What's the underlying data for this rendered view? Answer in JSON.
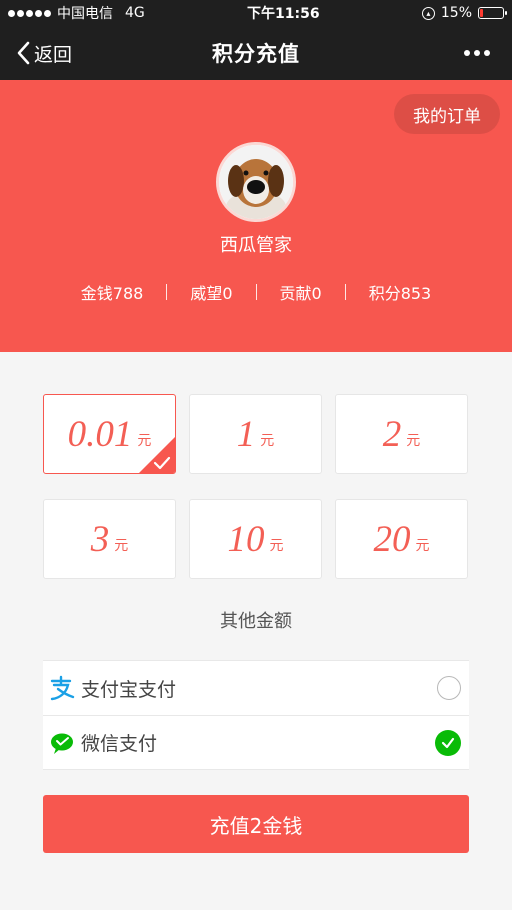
{
  "status_bar": {
    "carrier": "中国电信",
    "network": "4G",
    "time": "下午11:56",
    "battery_percent": "15%",
    "battery_level": 0.15
  },
  "nav": {
    "back_label": "返回",
    "title": "积分充值"
  },
  "header": {
    "orders_label": "我的订单",
    "username": "西瓜管家",
    "stats": [
      {
        "label": "金钱788"
      },
      {
        "label": "威望0"
      },
      {
        "label": "贡献0"
      },
      {
        "label": "积分853"
      }
    ]
  },
  "amounts": [
    {
      "value": "0.01",
      "unit": "元",
      "selected": true
    },
    {
      "value": "1",
      "unit": "元",
      "selected": false
    },
    {
      "value": "2",
      "unit": "元",
      "selected": false
    },
    {
      "value": "3",
      "unit": "元",
      "selected": false
    },
    {
      "value": "10",
      "unit": "元",
      "selected": false
    },
    {
      "value": "20",
      "unit": "元",
      "selected": false
    }
  ],
  "other_amount_label": "其他金额",
  "payment_methods": [
    {
      "label": "支付宝支付",
      "icon": "alipay-icon",
      "selected": false
    },
    {
      "label": "微信支付",
      "icon": "wechat-pay-icon",
      "selected": true
    }
  ],
  "submit_label": "充值2金钱",
  "colors": {
    "accent": "#f7574f",
    "nav_bg": "#1f1f1f",
    "amount_text": "#f35f55",
    "wechat_green": "#09bb07",
    "alipay_blue": "#1aa0e6"
  }
}
